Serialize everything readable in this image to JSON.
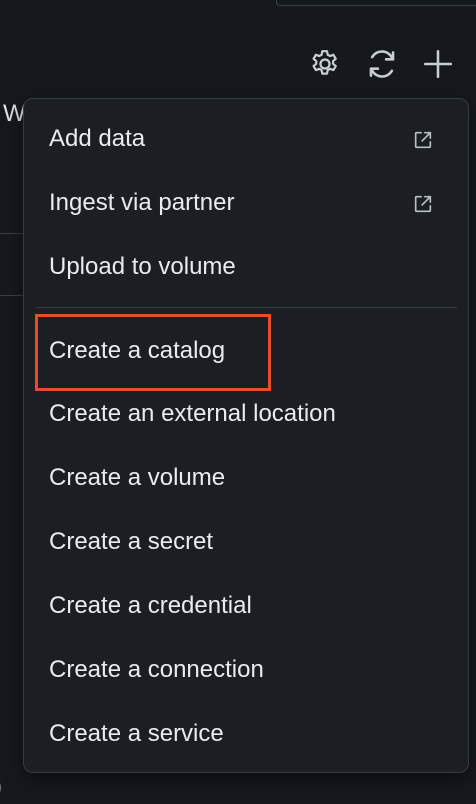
{
  "toolbar": {
    "settings_icon": "gear-icon",
    "refresh_icon": "refresh-icon",
    "add_icon": "plus-icon"
  },
  "background": {
    "partial_text": "W",
    "partial_paren": ")"
  },
  "menu": {
    "items": [
      {
        "label": "Add data",
        "icon": "external-link-icon"
      },
      {
        "label": "Ingest via partner",
        "icon": "external-link-icon"
      },
      {
        "label": "Upload to volume"
      },
      {
        "label": "Create a catalog",
        "highlighted": true
      },
      {
        "label": "Create an external location"
      },
      {
        "label": "Create a volume"
      },
      {
        "label": "Create a secret"
      },
      {
        "label": "Create a credential"
      },
      {
        "label": "Create a connection"
      },
      {
        "label": "Create a service"
      }
    ]
  },
  "colors": {
    "background": "#15191e",
    "menu_background": "#1b1f24",
    "text": "#e8ebef",
    "icon": "#c9ced5",
    "highlight": "#e84b2b"
  }
}
